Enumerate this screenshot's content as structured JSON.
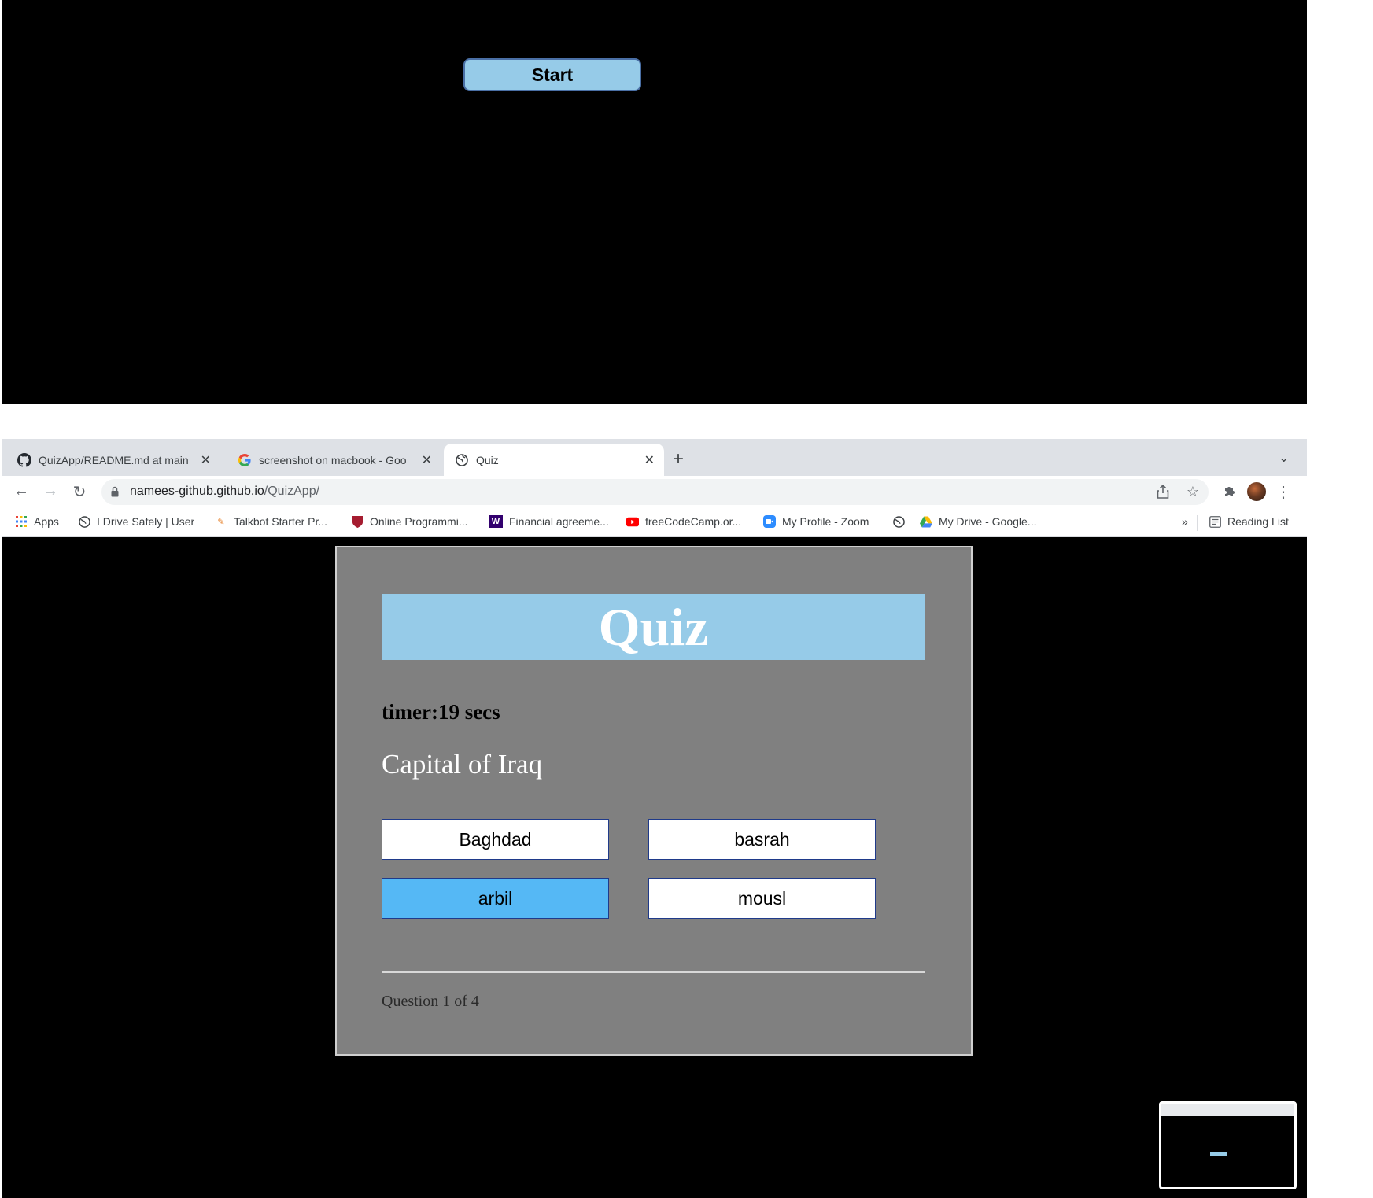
{
  "top_screenshot": {
    "start_label": "Start"
  },
  "browser": {
    "tabs": [
      {
        "label": "QuizApp/README.md at main ·",
        "icon": "github-icon"
      },
      {
        "label": "screenshot on macbook - Goo",
        "icon": "google-icon"
      },
      {
        "label": "Quiz",
        "icon": "globe-icon",
        "active": true
      }
    ],
    "new_tab_label": "+",
    "url_host": "namees-github.github.io",
    "url_path": "/QuizApp/",
    "bookmarks": [
      {
        "label": "Apps",
        "icon": "apps-grid-icon"
      },
      {
        "label": "I Drive Safely | User",
        "icon": "globe-icon"
      },
      {
        "label": "Talkbot Starter Pr...",
        "icon": "talkbot-icon"
      },
      {
        "label": "Online Programmi...",
        "icon": "harvard-shield-icon"
      },
      {
        "label": "Financial agreeme...",
        "icon": "uw-icon"
      },
      {
        "label": "freeCodeCamp.or...",
        "icon": "youtube-icon"
      },
      {
        "label": "My Profile - Zoom",
        "icon": "zoom-icon"
      },
      {
        "label": "",
        "icon": "globe-icon"
      },
      {
        "label": "My Drive - Google...",
        "icon": "google-drive-icon"
      }
    ],
    "overflow_label": "»",
    "reading_list_label": "Reading List"
  },
  "quiz": {
    "title": "Quiz",
    "timer": "timer:19 secs",
    "question": "Capital of Iraq",
    "answers": [
      "Baghdad",
      "basrah",
      "arbil",
      "mousl"
    ],
    "selected_answer": "arbil",
    "progress": "Question 1 of 4"
  },
  "colors": {
    "header_blue": "#96cbe8",
    "selected_blue": "#55b8f5",
    "card_gray": "#808080",
    "page_black": "#000000"
  }
}
